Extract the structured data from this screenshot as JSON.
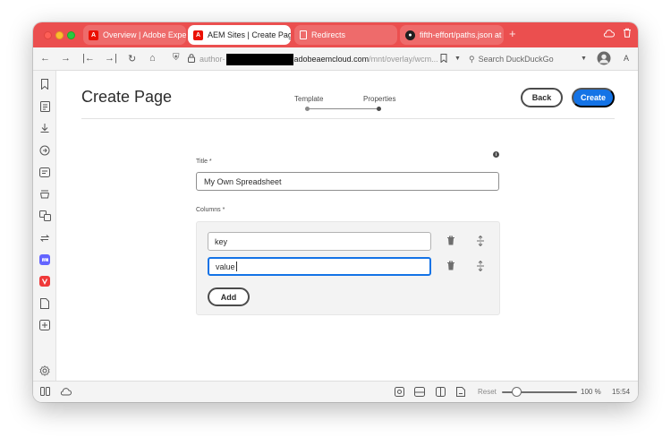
{
  "browser": {
    "tabs": [
      {
        "label": "Overview | Adobe Experie",
        "favicon": "adobe-icon",
        "active": false
      },
      {
        "label": "AEM Sites | Create Page",
        "favicon": "adobe-icon",
        "active": true
      },
      {
        "label": "Redirects",
        "favicon": "document-icon",
        "active": false
      },
      {
        "label": "fifth-effort/paths.json at m",
        "favicon": "github-icon",
        "active": false
      }
    ],
    "new_tab_glyph": "+",
    "url_prefix": "author-",
    "url_host": "adobeaemcloud.com",
    "url_path": "/mnt/overlay/wcm...",
    "search_placeholder": "Search DuckDuckGo",
    "reader_glyph": "A"
  },
  "page": {
    "title": "Create Page",
    "steps": [
      {
        "label": "Template",
        "complete": true
      },
      {
        "label": "Properties",
        "current": true
      }
    ],
    "back_label": "Back",
    "create_label": "Create",
    "title_field": {
      "label": "Title *",
      "value": "My Own Spreadsheet"
    },
    "columns_field": {
      "label": "Columns *",
      "items": [
        {
          "value": "key",
          "focused": false
        },
        {
          "value": "value",
          "focused": true
        }
      ],
      "add_label": "Add"
    }
  },
  "statusbar": {
    "reset_label": "Reset",
    "zoom": "100 %",
    "time": "15:54"
  },
  "colors": {
    "tabbar": "#eb4f4f",
    "accent": "#1473e6"
  }
}
